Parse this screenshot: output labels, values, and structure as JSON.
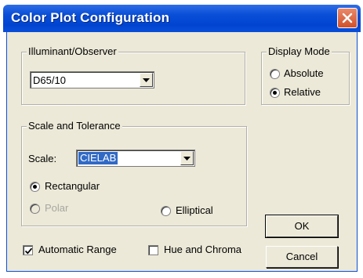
{
  "window": {
    "title": "Color Plot Configuration"
  },
  "illuminant": {
    "label": "Illuminant/Observer",
    "value": "D65/10"
  },
  "display_mode": {
    "label": "Display Mode",
    "options": [
      "Absolute",
      "Relative"
    ],
    "selected": "Relative"
  },
  "scale_group": {
    "label": "Scale and Tolerance",
    "scale_label": "Scale:",
    "scale_value": "CIELAB",
    "rectangular": "Rectangular",
    "polar": "Polar",
    "elliptical": "Elliptical",
    "selected": "Rectangular"
  },
  "options": {
    "automatic_range": "Automatic Range",
    "automatic_range_checked": true,
    "hue_chroma": "Hue and Chroma",
    "hue_chroma_checked": false
  },
  "buttons": {
    "ok": "OK",
    "cancel": "Cancel"
  },
  "icons": {
    "close": "close-icon",
    "dropdown": "chevron-down-icon",
    "check": "checkmark-icon"
  }
}
